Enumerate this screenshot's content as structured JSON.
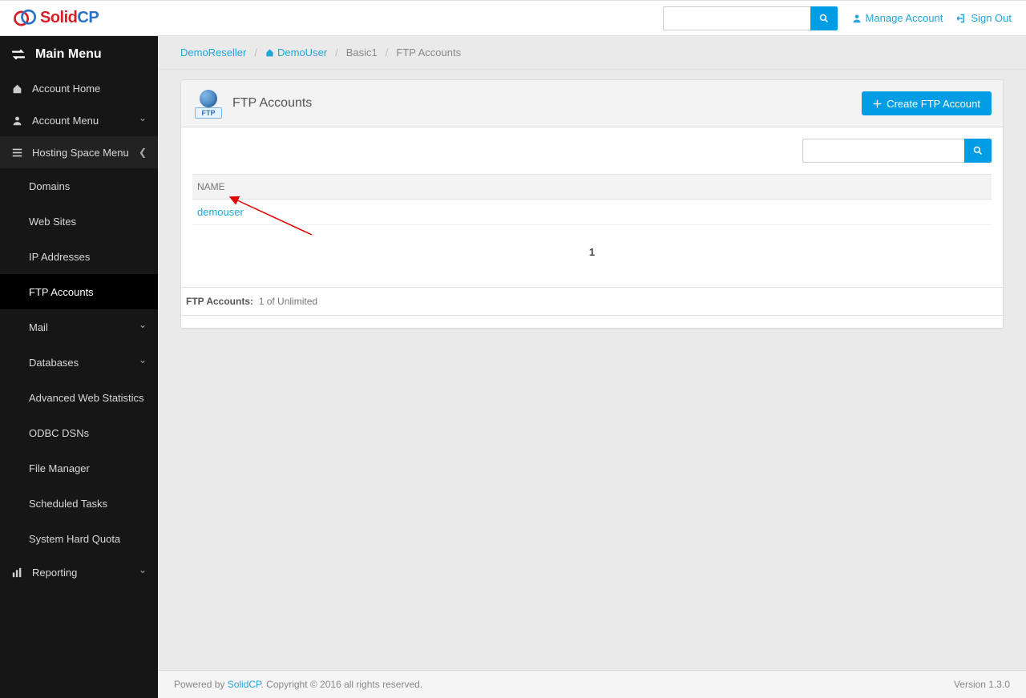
{
  "header": {
    "logo_solid": "Solid",
    "logo_cp": "CP",
    "manage_account": "Manage Account",
    "sign_out": "Sign Out"
  },
  "sidebar": {
    "title": "Main Menu",
    "items": [
      {
        "label": "Account Home"
      },
      {
        "label": "Account Menu"
      },
      {
        "label": "Hosting Space Menu"
      }
    ],
    "subitems": [
      {
        "label": "Domains"
      },
      {
        "label": "Web Sites"
      },
      {
        "label": "IP Addresses"
      },
      {
        "label": "FTP Accounts"
      },
      {
        "label": "Mail"
      },
      {
        "label": "Databases"
      },
      {
        "label": "Advanced Web Statistics"
      },
      {
        "label": "ODBC DSNs"
      },
      {
        "label": "File Manager"
      },
      {
        "label": "Scheduled Tasks"
      },
      {
        "label": "System Hard Quota"
      }
    ],
    "reporting": "Reporting"
  },
  "breadcrumb": {
    "items": [
      "DemoReseller",
      "DemoUser",
      "Basic1",
      "FTP Accounts"
    ]
  },
  "panel": {
    "ftp_badge": "FTP",
    "title": "FTP Accounts",
    "create_button": "Create FTP Account"
  },
  "table": {
    "header_name": "NAME",
    "rows": [
      {
        "name": "demouser"
      }
    ],
    "page": "1"
  },
  "quota": {
    "label": "FTP Accounts:",
    "value": "1 of Unlimited"
  },
  "footer": {
    "prefix": "Powered by ",
    "link": "SolidCP",
    "suffix": ". Copyright © 2016 all rights reserved.",
    "version": "Version 1.3.0"
  }
}
